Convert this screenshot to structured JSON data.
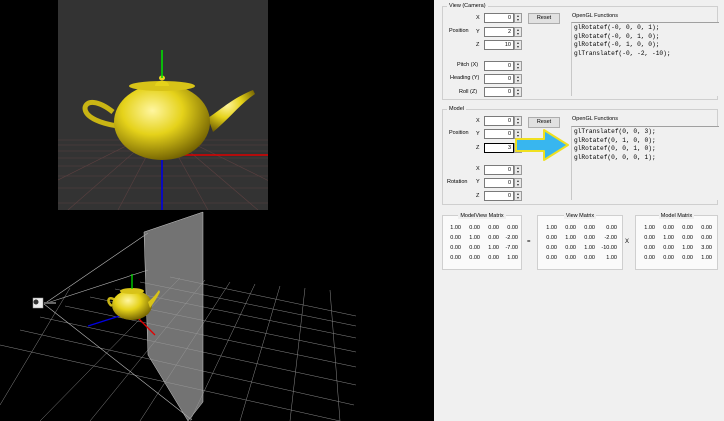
{
  "view_camera": {
    "title": "View (Camera)",
    "position_label": "Position",
    "x_label": "X",
    "y_label": "Y",
    "z_label": "Z",
    "x": "0",
    "y": "2",
    "z": "10",
    "pitch_label": "Pitch (X)",
    "heading_label": "Heading (Y)",
    "roll_label": "Roll (Z)",
    "pitch": "0",
    "heading": "0",
    "roll": "0",
    "reset_label": "Reset",
    "functions_title": "OpenGL Functions",
    "functions": [
      "glRotatef(-0, 0, 0, 1);",
      "glRotatef(-0, 0, 1, 0);",
      "glRotatef(-0, 1, 0, 0);",
      "glTranslatef(-0, -2, -10);"
    ]
  },
  "model": {
    "title": "Model",
    "position_label": "Position",
    "rotation_label": "Rotation",
    "x_label": "X",
    "y_label": "Y",
    "z_label": "Z",
    "x": "0",
    "y": "0",
    "z": "3",
    "rx": "0",
    "ry": "0",
    "rz": "0",
    "reset_label": "Reset",
    "functions_title": "OpenGL Functions",
    "functions": [
      "glTranslatef(0, 0, 3);",
      "glRotatef(0, 1, 0, 0);",
      "glRotatef(0, 0, 1, 0);",
      "glRotatef(0, 0, 0, 1);"
    ],
    "arrow_color": "#38b6ef"
  },
  "matrices": {
    "modelview_title": "ModelView Matrix",
    "view_title": "View Matrix",
    "model_title": "Model Matrix",
    "equals": "=",
    "times": "X",
    "modelview": [
      [
        "1.00",
        "0.00",
        "0.00",
        "0.00"
      ],
      [
        "0.00",
        "1.00",
        "0.00",
        "-2.00"
      ],
      [
        "0.00",
        "0.00",
        "1.00",
        "-7.00"
      ],
      [
        "0.00",
        "0.00",
        "0.00",
        "1.00"
      ]
    ],
    "view": [
      [
        "1.00",
        "0.00",
        "0.00",
        "0.00"
      ],
      [
        "0.00",
        "1.00",
        "0.00",
        "-2.00"
      ],
      [
        "0.00",
        "0.00",
        "1.00",
        "-10.00"
      ],
      [
        "0.00",
        "0.00",
        "0.00",
        "1.00"
      ]
    ],
    "model": [
      [
        "1.00",
        "0.00",
        "0.00",
        "0.00"
      ],
      [
        "0.00",
        "1.00",
        "0.00",
        "0.00"
      ],
      [
        "0.00",
        "0.00",
        "1.00",
        "3.00"
      ],
      [
        "0.00",
        "0.00",
        "0.00",
        "1.00"
      ]
    ]
  },
  "colors": {
    "teapot": "#e5d21a",
    "grid_top": "#6a3a3a",
    "grid_bottom": "#7a7a7a",
    "axis_x": "#e00000",
    "axis_y": "#00cc00",
    "axis_z": "#0000e0",
    "panel_bg": "#f0f0f0"
  }
}
